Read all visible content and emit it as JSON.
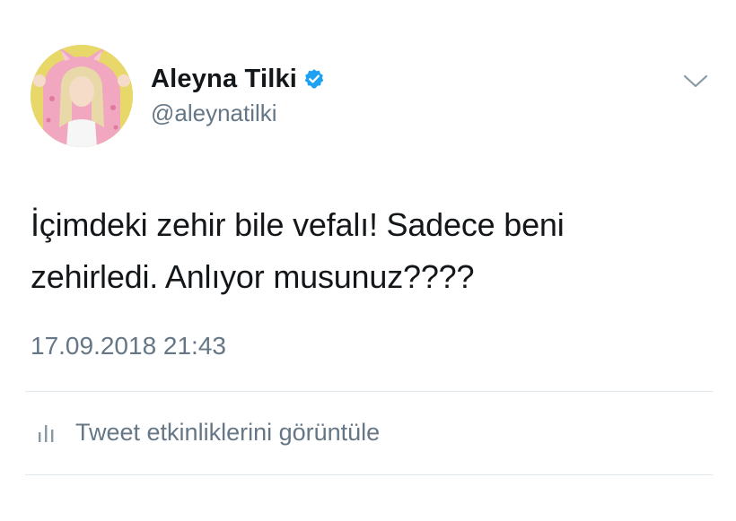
{
  "tweet": {
    "author": {
      "display_name": "Aleyna Tilki",
      "handle": "@aleynatilki",
      "verified": true,
      "verified_icon": "verified-badge-icon",
      "avatar_icon": "profile-photo"
    },
    "text_line1": "İçimdeki zehir bile vefalı! Sadece beni",
    "text_line2": "zehirledi. Anlıyor musunuz????",
    "timestamp": "17.09.2018 21:43",
    "more_menu_icon": "chevron-down-icon",
    "analytics": {
      "icon": "bar-chart-icon",
      "label": "Tweet etkinliklerini görüntüle"
    }
  },
  "colors": {
    "text_primary": "#14171a",
    "text_secondary": "#657786",
    "verified_blue": "#1da1f2",
    "divider": "#e1e8ed",
    "background": "#ffffff"
  }
}
